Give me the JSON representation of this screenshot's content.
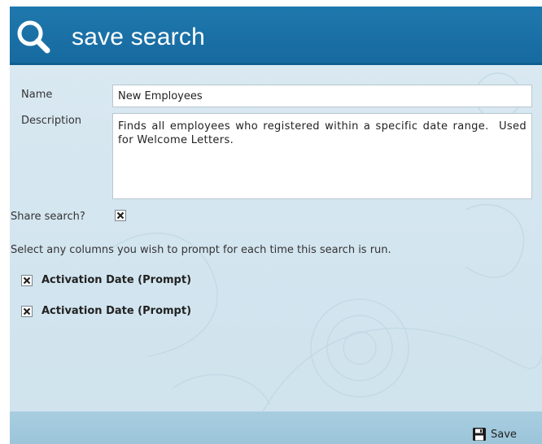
{
  "header": {
    "title": "save search",
    "icon": "search-icon"
  },
  "form": {
    "name_label": "Name",
    "name_value": "New Employees",
    "description_label": "Description",
    "description_value": "Finds all employees who registered within a specific date range.  Used for Welcome Letters.",
    "share_label": "Share search?",
    "share_checked": true,
    "prompt_instruction": "Select any columns you wish to prompt for each time this search is run."
  },
  "columns": [
    {
      "label": "Activation Date  (Prompt)",
      "checked": true
    },
    {
      "label": "Activation Date  (Prompt)",
      "checked": true
    }
  ],
  "footer": {
    "save_label": "Save",
    "save_icon": "floppy-disk-icon"
  },
  "colors": {
    "header": "#1f78ad",
    "panel": "#d6e7f1",
    "footer": "#a3cadd"
  }
}
